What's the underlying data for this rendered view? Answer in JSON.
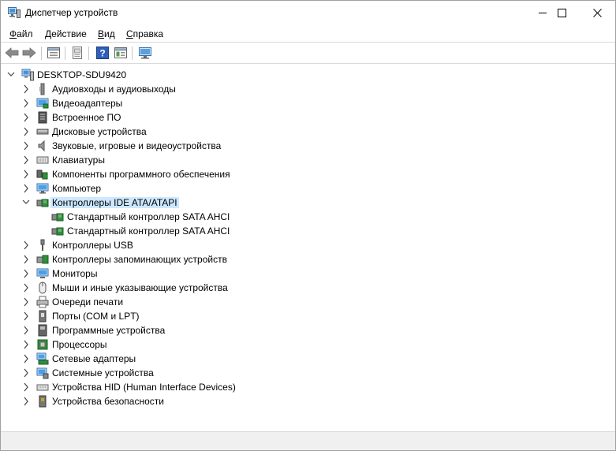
{
  "window": {
    "title": "Диспетчер устройств"
  },
  "menu": {
    "file": {
      "key": "Ф",
      "rest": "айл"
    },
    "action": {
      "key": "Д",
      "rest": "ействие"
    },
    "view": {
      "key": "В",
      "rest": "ид"
    },
    "help": {
      "key": "С",
      "rest": "правка"
    }
  },
  "toolbar": {
    "icons": [
      "back-arrow-icon",
      "forward-arrow-icon",
      "properties-icon",
      "update-driver-icon",
      "help-icon",
      "view-icon",
      "monitor-scan-icon"
    ]
  },
  "tree": {
    "root": "DESKTOP-SDU9420",
    "items": [
      {
        "label": "Аудиовходы и аудиовыходы",
        "icon": "audio-io-icon"
      },
      {
        "label": "Видеоадаптеры",
        "icon": "display-adapter-icon"
      },
      {
        "label": "Встроенное ПО",
        "icon": "firmware-icon"
      },
      {
        "label": "Дисковые устройства",
        "icon": "disk-drive-icon"
      },
      {
        "label": "Звуковые, игровые и видеоустройства",
        "icon": "sound-icon"
      },
      {
        "label": "Клавиатуры",
        "icon": "keyboard-icon"
      },
      {
        "label": "Компоненты программного обеспечения",
        "icon": "software-component-icon"
      },
      {
        "label": "Компьютер",
        "icon": "computer-icon"
      },
      {
        "label": "Контроллеры IDE ATA/ATAPI",
        "icon": "ide-controller-icon",
        "children": [
          {
            "label": "Стандартный контроллер SATA AHCI",
            "icon": "sata-controller-icon"
          },
          {
            "label": "Стандартный контроллер SATA AHCI",
            "icon": "sata-controller-icon"
          }
        ]
      },
      {
        "label": "Контроллеры USB",
        "icon": "usb-icon"
      },
      {
        "label": "Контроллеры запоминающих устройств",
        "icon": "storage-controller-icon"
      },
      {
        "label": "Мониторы",
        "icon": "monitor-icon"
      },
      {
        "label": "Мыши и иные указывающие устройства",
        "icon": "mouse-icon"
      },
      {
        "label": "Очереди печати",
        "icon": "printer-icon"
      },
      {
        "label": "Порты (COM и LPT)",
        "icon": "port-icon"
      },
      {
        "label": "Программные устройства",
        "icon": "software-device-icon"
      },
      {
        "label": "Процессоры",
        "icon": "processor-icon"
      },
      {
        "label": "Сетевые адаптеры",
        "icon": "network-adapter-icon"
      },
      {
        "label": "Системные устройства",
        "icon": "system-device-icon"
      },
      {
        "label": "Устройства HID (Human Interface Devices)",
        "icon": "hid-icon"
      },
      {
        "label": "Устройства безопасности",
        "icon": "security-device-icon"
      }
    ]
  },
  "colors": {
    "selection": "#cce8ff",
    "accent": "#0078d7",
    "chevron": "#444444"
  }
}
